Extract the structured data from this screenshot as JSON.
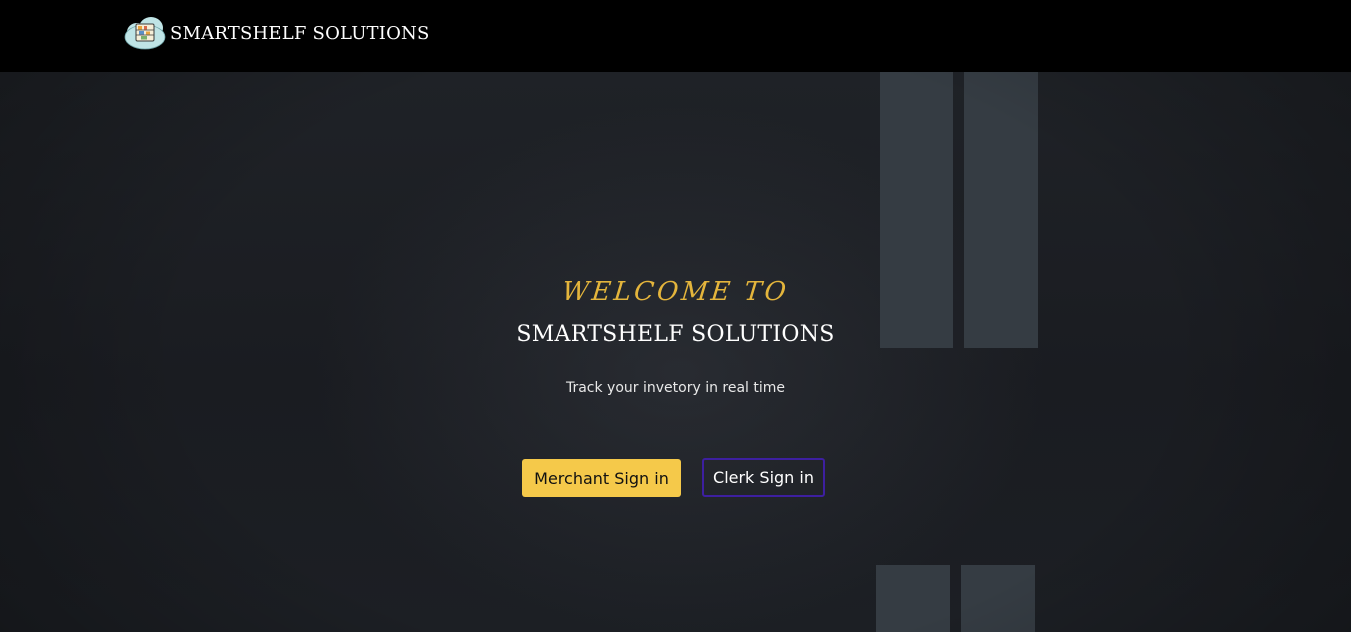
{
  "navbar": {
    "brand_name": "SMARTSHELF SOLUTIONS",
    "logo_icon": "cloud-shelf-logo-icon"
  },
  "hero": {
    "welcome": "WELCOME TO",
    "title": "SMARTSHELF SOLUTIONS",
    "tagline": "Track your invetory in real time",
    "merchant_button": "Merchant Sign in",
    "clerk_button": "Clerk Sign in"
  },
  "colors": {
    "navbar_bg": "#000000",
    "hero_bg": "#1b1e23",
    "accent_yellow": "#f5c94a",
    "welcome_gold": "#e4b53c",
    "clerk_border": "#3d1fa0",
    "decor_bar": "#353c43"
  }
}
